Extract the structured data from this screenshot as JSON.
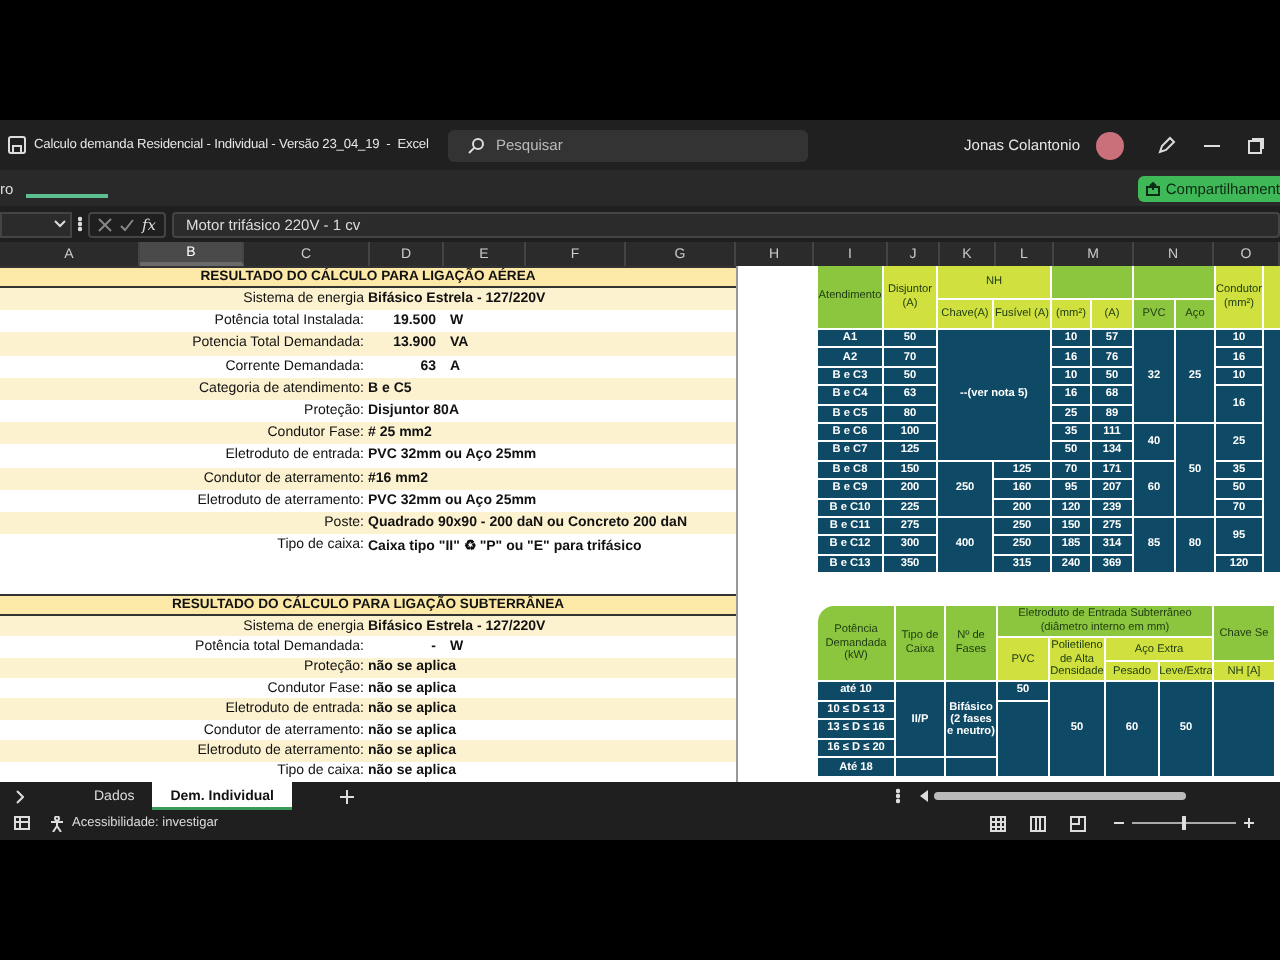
{
  "title_bar": {
    "title": "Calculo demanda Residencial - Individual - Versão 23_04_19  -  Excel",
    "search": {
      "placeholder": "Pesquisar"
    },
    "user_name": "Jonas Colantonio"
  },
  "ribbon": {
    "tab_fragment": "ro",
    "share_button": "Compartilhament"
  },
  "formula_bar": {
    "function_label": "fx",
    "value": "Motor trifásico 220V - 1 cv"
  },
  "columns": [
    {
      "label": "A",
      "selected": false
    },
    {
      "label": "B",
      "selected": true
    },
    {
      "label": "C",
      "selected": false
    },
    {
      "label": "D",
      "selected": false
    },
    {
      "label": "E",
      "selected": false
    },
    {
      "label": "F",
      "selected": false
    },
    {
      "label": "G",
      "selected": false
    },
    {
      "label": "H",
      "selected": false
    },
    {
      "label": "I",
      "selected": false
    },
    {
      "label": "J",
      "selected": false
    },
    {
      "label": "K",
      "selected": false
    },
    {
      "label": "L",
      "selected": false
    },
    {
      "label": "M",
      "selected": false
    },
    {
      "label": "N",
      "selected": false
    },
    {
      "label": "O",
      "selected": false
    }
  ],
  "aerial_result": {
    "title": "RESULTADO DO CÁLCULO PARA LIGAÇÃO AÉREA",
    "rows": [
      {
        "kind": "text",
        "label": "Sistema de energia",
        "value": "Bifásico Estrela - 127/220V"
      },
      {
        "kind": "quantity",
        "label": "Potência total Instalada:",
        "value": "19.500",
        "unit": "W"
      },
      {
        "kind": "quantity",
        "label": "Potencia Total Demandada:",
        "value": "13.900",
        "unit": "VA"
      },
      {
        "kind": "quantity",
        "label": "Corrente Demandada:",
        "value": "63",
        "unit": "A"
      },
      {
        "kind": "text",
        "label": "Categoria de atendimento:",
        "value": "B e C5"
      },
      {
        "kind": "text",
        "label": "Proteção:",
        "value": "Disjuntor 80A"
      },
      {
        "kind": "text",
        "label": "Condutor Fase:",
        "value": "# 25 mm2"
      },
      {
        "kind": "text",
        "label": "Eletroduto de entrada:",
        "value": "PVC 32mm ou Aço 25mm"
      },
      {
        "kind": "text",
        "label": "Condutor de aterramento:",
        "value": "#16 mm2"
      },
      {
        "kind": "text",
        "label": "Eletroduto de aterramento:",
        "value": "PVC 32mm ou Aço 25mm"
      },
      {
        "kind": "text",
        "label": "Poste:",
        "value": "Quadrado 90x90 - 200 daN ou Concreto 200 daN"
      },
      {
        "kind": "text",
        "label": "Tipo de caixa:",
        "value": "Caixa tipo \"II\" ♻ \"P\" ou \"E\" para trifásico"
      }
    ]
  },
  "underground_result": {
    "title": "RESULTADO DO CÁLCULO PARA LIGAÇÃO SUBTERRÂNEA",
    "rows": [
      {
        "kind": "text",
        "label": "Sistema de energia",
        "value": "Bifásico Estrela - 127/220V"
      },
      {
        "kind": "quantity",
        "label": "Potência total Demandada:",
        "value": "-",
        "unit": "W"
      },
      {
        "kind": "text",
        "label": "Proteção:",
        "value": "não se aplica"
      },
      {
        "kind": "text",
        "label": "Condutor Fase:",
        "value": "não se aplica"
      },
      {
        "kind": "text",
        "label": "Eletroduto de entrada:",
        "value": "não se aplica"
      },
      {
        "kind": "text",
        "label": "Condutor de aterramento:",
        "value": "não se aplica"
      },
      {
        "kind": "text",
        "label": "Eletroduto de aterramento:",
        "value": "não se aplica"
      },
      {
        "kind": "text",
        "label": "Tipo de caixa:",
        "value": "não se aplica"
      }
    ]
  },
  "supply_table": {
    "header": [
      "Atendimento",
      "Disjuntor (A)",
      "NH",
      "Chave(A)",
      "Fusível (A)",
      "(mm²)",
      "(A)",
      "PVC",
      "Aço",
      "Condutor (mm²)"
    ],
    "columns": [
      [
        "A1",
        "A2",
        "B e C3",
        "B e C4",
        "B e C5",
        "B e C6",
        "B e C7",
        "B e C8",
        "B e C9",
        "B e C10",
        "B e C11",
        "B e C12",
        "B e C13"
      ],
      [
        "50",
        "70",
        "50",
        "63",
        "80",
        "100",
        "125",
        "150",
        "200",
        "225",
        "275",
        "300",
        "350"
      ],
      [
        "--(ver nota 5)",
        "250",
        "400"
      ],
      [
        "125",
        "160",
        "200",
        "250",
        "250",
        "315"
      ],
      [
        "10",
        "16",
        "10",
        "16",
        "25",
        "35",
        "50",
        "70",
        "95",
        "120",
        "150",
        "185",
        "240"
      ],
      [
        "57",
        "76",
        "50",
        "68",
        "89",
        "111",
        "134",
        "171",
        "207",
        "239",
        "275",
        "314",
        "369"
      ],
      [
        "32",
        "40",
        "60",
        "85"
      ],
      [
        "25",
        "50",
        "80"
      ],
      [
        "10",
        "16",
        "10",
        "16",
        "25",
        "35",
        "50",
        "70",
        "95",
        "120"
      ]
    ]
  },
  "underground_table": {
    "header": [
      "Potência Demandada (kW)",
      "Tipo de Caixa",
      "Nº de Fases",
      "Eletroduto de Entrada Subterrâneo (diâmetro interno em mm)",
      "Chave Se",
      "PVC",
      "Polietileno de Alta Densidade",
      "Aço Extra",
      "Pesado",
      "Leve/Extra",
      "NH [A]"
    ],
    "columns": [
      [
        "até 10",
        "10 ≤ D ≤ 13",
        "13 ≤ D ≤ 16",
        "16 ≤ D ≤ 20",
        "Até 18"
      ],
      [
        "II/P"
      ],
      [
        "Bifásico (2 fases e neutro)"
      ],
      [
        "50"
      ],
      [
        "50"
      ],
      [
        "60"
      ],
      [
        "50"
      ]
    ]
  },
  "sheet_tabs": [
    {
      "label": "Dados",
      "selected": false
    },
    {
      "label": "Dem. Individual",
      "selected": true
    }
  ],
  "status_bar": {
    "accessibility": "Acessibilidade: investigar",
    "zoom": {
      "level": 0.5
    }
  }
}
